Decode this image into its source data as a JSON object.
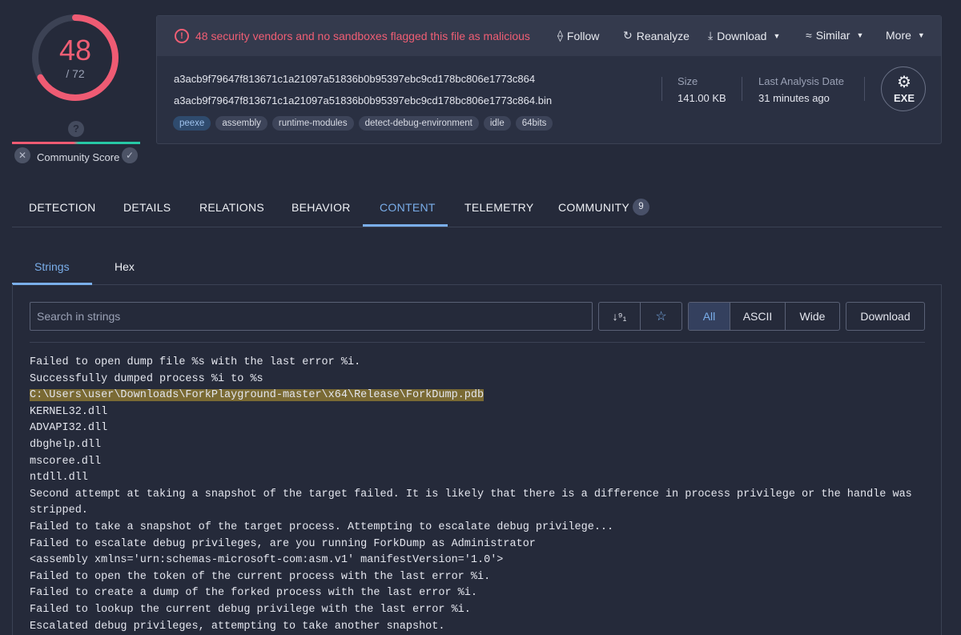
{
  "score": {
    "detections": "48",
    "total": "/ 72",
    "detection_ratio": 0.6667
  },
  "community": {
    "label": "Community Score",
    "unknown_icon": "question-icon",
    "downvote_icon": "x-icon",
    "upvote_icon": "check-icon"
  },
  "alert": {
    "text": "48 security vendors and no sandboxes flagged this file as malicious",
    "icon": "alert-circle-icon"
  },
  "actions": {
    "follow": "Follow",
    "reanalyze": "Reanalyze",
    "download": "Download",
    "similar": "Similar",
    "more": "More"
  },
  "file": {
    "sha256": "a3acb9f79647f813671c1a21097a51836b0b95397ebc9cd178bc806e1773c864",
    "name": "a3acb9f79647f813671c1a21097a51836b0b95397ebc9cd178bc806e1773c864.bin",
    "tags": [
      "peexe",
      "assembly",
      "runtime-modules",
      "detect-debug-environment",
      "idle",
      "64bits"
    ],
    "size_label": "Size",
    "size": "141.00 KB",
    "last_analysis_label": "Last Analysis Date",
    "last_analysis": "31 minutes ago",
    "type_badge": "EXE"
  },
  "main_tabs": [
    "DETECTION",
    "DETAILS",
    "RELATIONS",
    "BEHAVIOR",
    "CONTENT",
    "TELEMETRY",
    "COMMUNITY"
  ],
  "community_count": "9",
  "active_main_tab": "CONTENT",
  "sub_tabs": [
    "Strings",
    "Hex"
  ],
  "active_sub_tab": "Strings",
  "search": {
    "placeholder": "Search in strings"
  },
  "filters": {
    "all": "All",
    "ascii": "ASCII",
    "wide": "Wide",
    "selected": "All"
  },
  "download_button": "Download",
  "strings": [
    "Failed to open dump file %s with the last error %i.",
    "Successfully dumped process %i to %s",
    "C:\\Users\\user\\Downloads\\ForkPlayground-master\\x64\\Release\\ForkDump.pdb",
    "KERNEL32.dll",
    "ADVAPI32.dll",
    "dbghelp.dll",
    "mscoree.dll",
    "ntdll.dll",
    "Second attempt at taking a snapshot of the target failed. It is likely that there is a difference in process privilege or the handle was stripped.",
    "Failed to take a snapshot of the target process. Attempting to escalate debug privilege...",
    "Failed to escalate debug privileges, are you running ForkDump as Administrator",
    "<assembly xmlns='urn:schemas-microsoft-com:asm.v1' manifestVersion='1.0'>",
    "Failed to open the token of the current process with the last error %i.",
    "Failed to create a dump of the forked process with the last error %i.",
    "Failed to lookup the current debug privilege with the last error %i.",
    "Escalated debug privileges, attempting to take another snapshot."
  ],
  "highlighted_string_index": 2
}
